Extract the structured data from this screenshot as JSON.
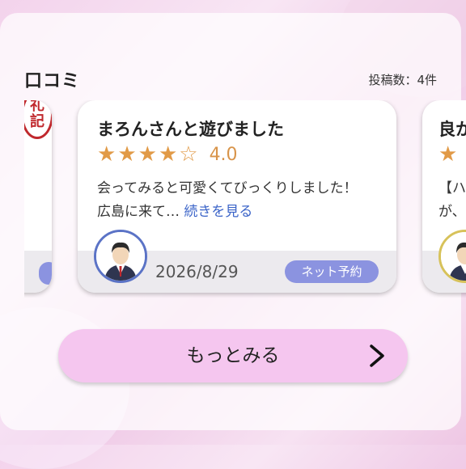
{
  "section": {
    "title": "口コミ",
    "post_count": "投稿数：4件"
  },
  "reviews": {
    "left_card": {
      "stamp_text": "礼記"
    },
    "main_card": {
      "title": "まろんさんと遊びました",
      "stars_filled": 4,
      "stars_total": 5,
      "rating_text": "4.0",
      "body": "会ってみると可愛くてびっくりしました！ 広島に来て…",
      "read_more": "続きを見る",
      "date": "2026/8/29",
      "badge": "ネット予約"
    },
    "right_card": {
      "title": "良か",
      "text_line1": "【ハ",
      "text_line2": "が、"
    }
  },
  "more_button": {
    "label": "もっとみる"
  },
  "colors": {
    "star": "#e19a47",
    "rating_text": "#d8944a",
    "badge_bg": "#8b93e0",
    "button_bg": "#f5c6ef",
    "link": "#3b64c8"
  },
  "icons": [
    "person-avatar-icon",
    "star-icon",
    "chevron-right-icon"
  ]
}
